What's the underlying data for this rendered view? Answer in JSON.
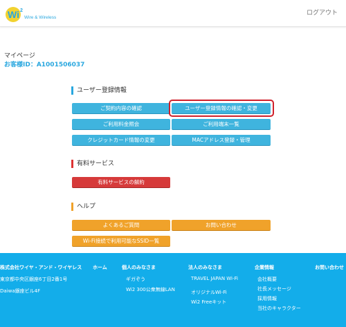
{
  "header": {
    "logo_main": "Wi",
    "logo_super": "2",
    "logo_sub": "Wire & Wireless",
    "logout_label": "ログアウト"
  },
  "account": {
    "title": "マイページ",
    "customer_id": "お客様ID：A1001506037"
  },
  "sections": {
    "user": {
      "heading": "ユーザー登録情報",
      "buttons": [
        "ご契約内容の確認",
        "ユーザー登録情報の確認・変更",
        "ご利用料金照会",
        "ご利用端末一覧",
        "クレジットカード情報の変更",
        "MACアドレス登録・管理"
      ]
    },
    "paid": {
      "heading": "有料サービス",
      "buttons": [
        "有料サービスの解約"
      ]
    },
    "help": {
      "heading": "ヘルプ",
      "buttons": [
        "よくあるご質問",
        "お問い合わせ",
        "Wi-Fi接続で利用可能なSSID一覧"
      ]
    }
  },
  "footer": {
    "company_name": "株式会社ワイヤ・アンド・ワイヤレス",
    "address1": "東京都中央区銀座6丁目2番1号",
    "address2": "Daiwa銀座ビル4F",
    "home": "ホーム",
    "personal": {
      "heading": "個人のみなさま",
      "links": [
        "ギガぞう",
        "Wi2 300公衆無線LAN"
      ]
    },
    "business": {
      "heading": "法人のみなさま",
      "links": [
        "TRAVEL JAPAN Wi-Fi",
        "オリジナルWi-Fi",
        "Wi2 Freeキット"
      ]
    },
    "corporate": {
      "heading": "企業情報",
      "links": [
        "会社概要",
        "社長メッセージ",
        "採用情報",
        "当社のキャラクター"
      ]
    },
    "contact": "お問い合わせ"
  },
  "colors": {
    "primary_blue": "#3fb4de",
    "footer_blue": "#13adea",
    "danger_red": "#d63a3a",
    "help_orange": "#f0a22a",
    "highlight_red": "#d0202a"
  }
}
